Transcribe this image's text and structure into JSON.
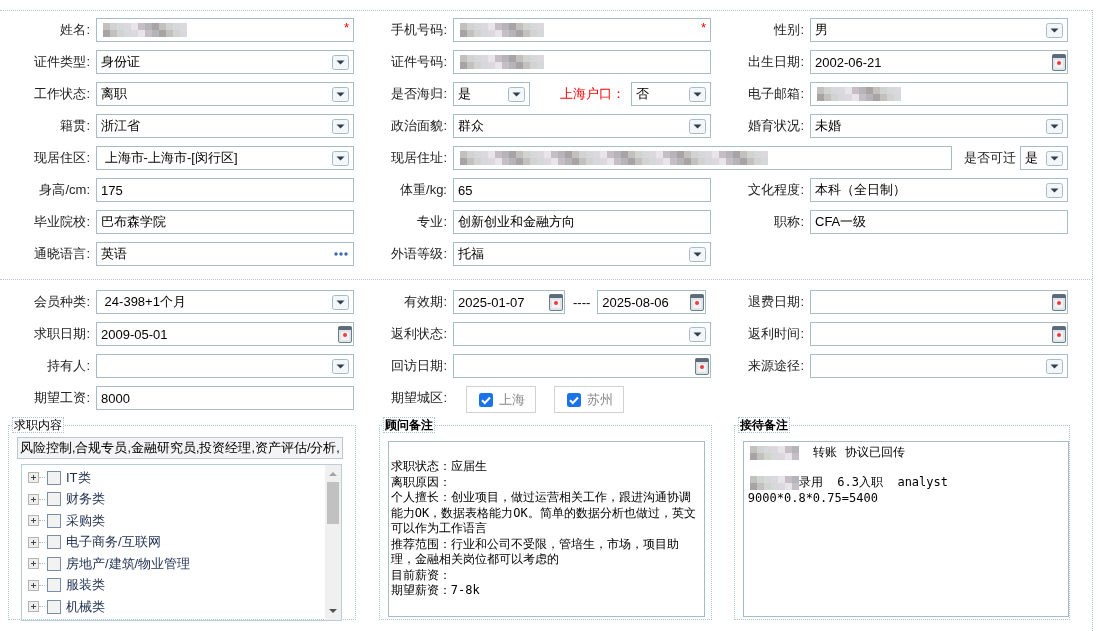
{
  "personal_section": {
    "rows": [
      [
        {
          "label": "姓名:",
          "controls": [
            {
              "kind": "text",
              "redacted": true,
              "required_mark": "*"
            }
          ]
        },
        {
          "label": "手机号码:",
          "controls": [
            {
              "kind": "text",
              "redacted": true,
              "required_mark": "*"
            }
          ]
        },
        {
          "label": "性别:",
          "controls": [
            {
              "kind": "select",
              "value": "男"
            }
          ]
        }
      ],
      [
        {
          "label": "证件类型:",
          "controls": [
            {
              "kind": "select",
              "value": "身份证"
            }
          ]
        },
        {
          "label": "证件号码:",
          "controls": [
            {
              "kind": "text",
              "redacted": true
            }
          ]
        },
        {
          "label": "出生日期:",
          "controls": [
            {
              "kind": "date",
              "value": "2002-06-21"
            }
          ]
        }
      ],
      [
        {
          "label": "工作状态:",
          "controls": [
            {
              "kind": "select",
              "value": "离职"
            }
          ]
        },
        {
          "label": "是否海归:",
          "controls": [
            {
              "kind": "select",
              "value": "是"
            },
            {
              "kind": "label",
              "text": "上海户口：",
              "emphasized": true
            },
            {
              "kind": "select",
              "value": "否"
            }
          ]
        },
        {
          "label": "电子邮箱:",
          "controls": [
            {
              "kind": "text",
              "redacted": true
            }
          ]
        }
      ],
      [
        {
          "label": "籍贯:",
          "controls": [
            {
              "kind": "select",
              "value": "浙江省"
            }
          ]
        },
        {
          "label": "政治面貌:",
          "controls": [
            {
              "kind": "select",
              "value": "群众"
            }
          ]
        },
        {
          "label": "婚育状况:",
          "controls": [
            {
              "kind": "select",
              "value": "未婚"
            }
          ]
        }
      ],
      [
        {
          "label": "现居住区:",
          "controls": [
            {
              "kind": "select",
              "value": " 上海市-上海市-[闵行区]"
            }
          ]
        },
        {
          "label": "现居住址:",
          "controls": [
            {
              "kind": "text",
              "redacted": true
            },
            {
              "kind": "label",
              "text": "是否可迁",
              "emphasized": false
            },
            {
              "kind": "select",
              "value": "是"
            }
          ]
        }
      ],
      [
        {
          "label": "身高/cm:",
          "controls": [
            {
              "kind": "text",
              "value": "175"
            }
          ]
        },
        {
          "label": "体重/kg:",
          "controls": [
            {
              "kind": "text",
              "value": "65"
            }
          ]
        },
        {
          "label": "文化程度:",
          "controls": [
            {
              "kind": "select",
              "value": "本科（全日制）"
            }
          ]
        }
      ],
      [
        {
          "label": "毕业院校:",
          "controls": [
            {
              "kind": "text",
              "value": "巴布森学院"
            }
          ]
        },
        {
          "label": "专业:",
          "controls": [
            {
              "kind": "text",
              "value": "创新创业和金融方向"
            }
          ]
        },
        {
          "label": "职称:",
          "controls": [
            {
              "kind": "text",
              "value": "CFA一级"
            }
          ]
        }
      ],
      [
        {
          "label": "通晓语言:",
          "controls": [
            {
              "kind": "lookup",
              "value": "英语"
            }
          ]
        },
        {
          "label": "外语等级:",
          "controls": [
            {
              "kind": "select",
              "value": "托福"
            }
          ]
        }
      ]
    ]
  },
  "membership_section": {
    "rows": [
      [
        {
          "label": "会员种类:",
          "controls": [
            {
              "kind": "select",
              "value": " 24-398+1个月"
            }
          ]
        },
        {
          "label": "有效期:",
          "controls": [
            {
              "kind": "date",
              "value": "2025-01-07"
            },
            {
              "kind": "separator",
              "text": "----"
            },
            {
              "kind": "date",
              "value": "2025-08-06"
            }
          ]
        },
        {
          "label": "退费日期:",
          "controls": [
            {
              "kind": "date"
            }
          ]
        }
      ],
      [
        {
          "label": "求职日期:",
          "controls": [
            {
              "kind": "date",
              "value": "2009-05-01"
            }
          ]
        },
        {
          "label": "返利状态:",
          "controls": [
            {
              "kind": "select"
            }
          ]
        },
        {
          "label": "返利时间:",
          "controls": [
            {
              "kind": "date"
            }
          ]
        }
      ],
      [
        {
          "label": "持有人:",
          "controls": [
            {
              "kind": "select"
            }
          ]
        },
        {
          "label": "回访日期:",
          "controls": [
            {
              "kind": "date"
            }
          ]
        },
        {
          "label": "来源途径:",
          "controls": [
            {
              "kind": "select"
            }
          ]
        }
      ],
      [
        {
          "label": "期望工资:",
          "controls": [
            {
              "kind": "text",
              "value": "8000"
            }
          ]
        },
        {
          "label": "期望城区:",
          "controls": [
            {
              "kind": "checkbutton",
              "text": "上海",
              "checked": true
            },
            {
              "kind": "checkbutton",
              "text": "苏州",
              "checked": true
            }
          ]
        }
      ]
    ]
  },
  "job_content": {
    "title": "求职内容",
    "summary": "风险控制,合规专员,金融研究员,投资经理,资产评估/分析,",
    "tree": [
      {
        "label": "IT类",
        "checked": false,
        "expanded": false
      },
      {
        "label": "财务类",
        "checked": false,
        "expanded": false
      },
      {
        "label": "采购类",
        "checked": false,
        "expanded": false
      },
      {
        "label": "电子商务/互联网",
        "checked": false,
        "expanded": false
      },
      {
        "label": "房地产/建筑/物业管理",
        "checked": false,
        "expanded": false
      },
      {
        "label": "服装类",
        "checked": false,
        "expanded": false
      },
      {
        "label": "机械类",
        "checked": false,
        "expanded": false
      }
    ]
  },
  "advisor_notes": {
    "title": "顾问备注",
    "paragraphs": [
      "求职状态：应届生",
      "离职原因：",
      "个人擅长：创业项目，做过运营相关工作，跟进沟通协调能力OK，数据表格能力OK。简单的数据分析也做过，英文可以作为工作语言",
      "推荐范围：行业和公司不受限，管培生，市场，项目助理，金融相关岗位都可以考虑的",
      "目前薪资：",
      "期望薪资：7-8k"
    ]
  },
  "reception_notes": {
    "title": "接待备注",
    "lines": [
      {
        "redacted": true,
        "text": "  转账 协议已回传"
      },
      {
        "redacted": true,
        "text": "录用  6.3入职  analyst"
      },
      {
        "redacted": false,
        "text": "9000*0.8*0.75=5400"
      }
    ]
  }
}
